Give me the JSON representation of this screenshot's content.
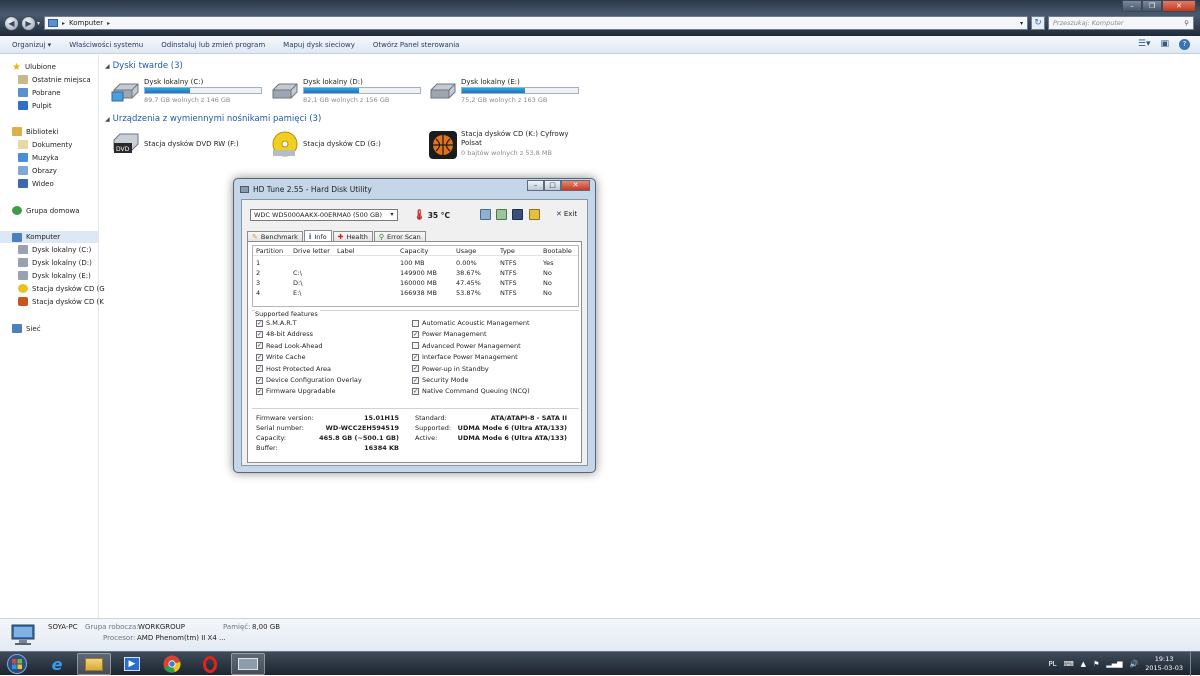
{
  "explorer": {
    "address": "Komputer",
    "search_placeholder": "Przeszukaj: Komputer",
    "commands": [
      "Organizuj ▾",
      "Właściwości systemu",
      "Odinstaluj lub zmień program",
      "Mapuj dysk sieciowy",
      "Otwórz Panel sterowania"
    ]
  },
  "sidebar": {
    "favorites": "Ulubione",
    "fav_items": [
      "Ostatnie miejsca",
      "Pobrane",
      "Pulpit"
    ],
    "libraries": "Biblioteki",
    "lib_items": [
      "Dokumenty",
      "Muzyka",
      "Obrazy",
      "Wideo"
    ],
    "homegroup": "Grupa domowa",
    "computer": "Komputer",
    "comp_items": [
      "Dysk lokalny (C:)",
      "Dysk lokalny (D:)",
      "Dysk lokalny (E:)",
      "Stacja dysków CD (G",
      "Stacja dysków CD (K"
    ],
    "network": "Sieć"
  },
  "hard_drives": {
    "title": "Dyski twarde (3)",
    "items": [
      {
        "name": "Dysk lokalny (C:)",
        "free": "89,7 GB wolnych z 146 GB",
        "used_fraction": 0.39
      },
      {
        "name": "Dysk lokalny (D:)",
        "free": "82,1 GB wolnych z 156 GB",
        "used_fraction": 0.47
      },
      {
        "name": "Dysk lokalny (E:)",
        "free": "75,2 GB wolnych z 163 GB",
        "used_fraction": 0.54
      }
    ]
  },
  "removable": {
    "title": "Urządzenia z wymiennymi nośnikami pamięci (3)",
    "items": [
      {
        "name": "Stacja dysków DVD RW (F:)"
      },
      {
        "name": "Stacja dysków CD (G:)"
      },
      {
        "name": "Stacja dysków CD (K:) Cyfrowy",
        "name2": "Polsat",
        "free": "0 bajtów wolnych z 53,8 MB"
      }
    ]
  },
  "details": {
    "pc_name": "SOYA-PC",
    "workgroup_label": "Grupa robocza:",
    "workgroup": "WORKGROUP",
    "memory_label": "Pamięć:",
    "memory": "8,00 GB",
    "cpu_label": "Procesor:",
    "cpu": "AMD Phenom(tm) II X4 ..."
  },
  "tray": {
    "lang": "PL",
    "time": "19:13",
    "date": "2015-03-03"
  },
  "hdtune": {
    "title": "HD Tune 2.55 - Hard Disk Utility",
    "drive": "WDC WD5000AAKX-00ERMA0 (500 GB)",
    "temperature": "35 °C",
    "exit_label": "Exit",
    "tabs": [
      "Benchmark",
      "Info",
      "Health",
      "Error Scan"
    ],
    "partition_headers": [
      "Partition",
      "Drive letter",
      "Label",
      "Capacity",
      "Usage",
      "Type",
      "Bootable"
    ],
    "partitions": [
      [
        "1",
        "",
        "",
        "100 MB",
        "0.00%",
        "NTFS",
        "Yes"
      ],
      [
        "2",
        "C:\\",
        "",
        "149900 MB",
        "38.67%",
        "NTFS",
        "No"
      ],
      [
        "3",
        "D:\\",
        "",
        "160000 MB",
        "47.45%",
        "NTFS",
        "No"
      ],
      [
        "4",
        "E:\\",
        "",
        "166938 MB",
        "53.87%",
        "NTFS",
        "No"
      ]
    ],
    "features_label": "Supported features",
    "features_left": [
      "S.M.A.R.T",
      "48-bit Address",
      "Read Look-Ahead",
      "Write Cache",
      "Host Protected Area",
      "Device Configuration Overlay",
      "Firmware Upgradable"
    ],
    "features_left_checked": [
      true,
      true,
      true,
      true,
      true,
      true,
      true
    ],
    "features_right": [
      "Automatic Acoustic Management",
      "Power Management",
      "Advanced Power Management",
      "Interface Power Management",
      "Power-up in Standby",
      "Security Mode",
      "Native Command Queuing (NCQ)"
    ],
    "features_right_checked": [
      false,
      true,
      false,
      true,
      true,
      true,
      true
    ],
    "info": {
      "firmware_label": "Firmware version:",
      "firmware": "15.01H15",
      "serial_label": "Serial number:",
      "serial": "WD-WCC2EH594519",
      "capacity_label": "Capacity:",
      "capacity": "465.8 GB (~500.1 GB)",
      "buffer_label": "Buffer:",
      "buffer": "16384 KB",
      "standard_label": "Standard:",
      "standard": "ATA/ATAPI-8 - SATA II",
      "supported_label": "Supported:",
      "supported": "UDMA Mode 6 (Ultra ATA/133)",
      "active_label": "Active:",
      "active": "UDMA Mode 6 (Ultra ATA/133)"
    }
  }
}
